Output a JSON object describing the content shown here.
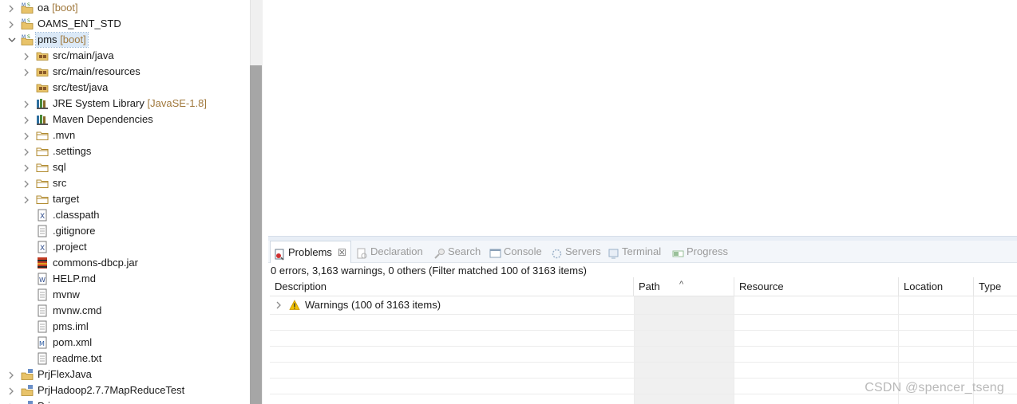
{
  "explorer": {
    "rows": [
      {
        "label": "oa",
        "decor": "[boot]",
        "icon": "maven-project-icon"
      },
      {
        "label": "OAMS_ENT_STD",
        "decor": "",
        "icon": "maven-project-icon"
      },
      {
        "label": "pms",
        "decor": "[boot]",
        "icon": "maven-project-icon"
      },
      {
        "label": "src/main/java",
        "decor": "",
        "icon": "source-folder-icon"
      },
      {
        "label": "src/main/resources",
        "decor": "",
        "icon": "source-folder-icon"
      },
      {
        "label": "src/test/java",
        "decor": "",
        "icon": "source-folder-icon"
      },
      {
        "label": "JRE System Library",
        "decor": "[JavaSE-1.8]",
        "icon": "library-icon"
      },
      {
        "label": "Maven Dependencies",
        "decor": "",
        "icon": "library-icon"
      },
      {
        "label": ".mvn",
        "decor": "",
        "icon": "folder-icon"
      },
      {
        "label": ".settings",
        "decor": "",
        "icon": "folder-icon"
      },
      {
        "label": "sql",
        "decor": "",
        "icon": "folder-icon"
      },
      {
        "label": "src",
        "decor": "",
        "icon": "folder-icon"
      },
      {
        "label": "target",
        "decor": "",
        "icon": "folder-icon"
      },
      {
        "label": ".classpath",
        "decor": "",
        "icon": "xml-file-icon"
      },
      {
        "label": ".gitignore",
        "decor": "",
        "icon": "text-file-icon"
      },
      {
        "label": ".project",
        "decor": "",
        "icon": "xml-file-icon"
      },
      {
        "label": "commons-dbcp.jar",
        "decor": "",
        "icon": "jar-file-icon"
      },
      {
        "label": "HELP.md",
        "decor": "",
        "icon": "markdown-file-icon"
      },
      {
        "label": "mvnw",
        "decor": "",
        "icon": "text-file-icon"
      },
      {
        "label": "mvnw.cmd",
        "decor": "",
        "icon": "text-file-icon"
      },
      {
        "label": "pms.iml",
        "decor": "",
        "icon": "text-file-icon"
      },
      {
        "label": "pom.xml",
        "decor": "",
        "icon": "maven-pom-icon"
      },
      {
        "label": "readme.txt",
        "decor": "",
        "icon": "text-file-icon"
      },
      {
        "label": "PrjFlexJava",
        "decor": "",
        "icon": "project-icon"
      },
      {
        "label": "PrjHadoop2.7.7MapReduceTest",
        "decor": "",
        "icon": "project-icon"
      },
      {
        "label": "Prj...",
        "decor": "",
        "icon": "project-icon"
      }
    ]
  },
  "panel": {
    "tabs": [
      {
        "label": "Problems",
        "icon": "problems-icon",
        "active": true
      },
      {
        "label": "Declaration",
        "icon": "declaration-icon",
        "active": false
      },
      {
        "label": "Search",
        "icon": "search-icon",
        "active": false
      },
      {
        "label": "Console",
        "icon": "console-icon",
        "active": false
      },
      {
        "label": "Servers",
        "icon": "servers-icon",
        "active": false
      },
      {
        "label": "Terminal",
        "icon": "terminal-icon",
        "active": false
      },
      {
        "label": "Progress",
        "icon": "progress-icon",
        "active": false
      }
    ],
    "close_glyph": "☒",
    "summary": "0 errors, 3,163 warnings, 0 others (Filter matched 100 of 3163 items)",
    "columns": [
      "Description",
      "Path",
      "Resource",
      "Location",
      "Type"
    ],
    "sort_glyph": "^",
    "warnings_row": "Warnings (100 of 3163 items)"
  },
  "watermark": "CSDN @spencer_tseng",
  "colors": {
    "selection": "#dbe9f7",
    "decor_text": "#a0783c",
    "warning": "#f2b800",
    "tab_bar": "#f3f6fa"
  }
}
